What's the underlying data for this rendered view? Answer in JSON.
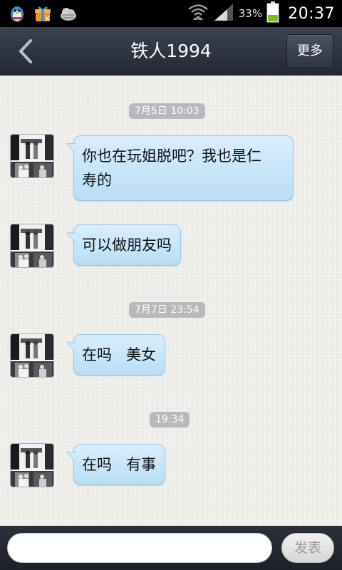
{
  "status_bar": {
    "battery_percent": "33%",
    "time": "20:37",
    "notification_icons": [
      "qq-penguin-icon",
      "gift-box-icon",
      "cloud-icon"
    ]
  },
  "title_bar": {
    "title": "铁人1994",
    "more_label": "更多"
  },
  "chat": {
    "timestamps": [
      "7月5日 10:03",
      "7月7日 23:54",
      "19:34"
    ],
    "messages": [
      {
        "line1": "你也在玩姐脱吧？我也是仁",
        "line2": "寿的"
      },
      {
        "line1": "可以做朋友吗",
        "line2": ""
      },
      {
        "line1": "在吗   美女",
        "line2": ""
      },
      {
        "line1": "在吗   有事",
        "line2": ""
      }
    ]
  },
  "input_bar": {
    "input_value": "",
    "send_label": "发表"
  },
  "colors": {
    "bubble": "#c8e6f9",
    "bar_dark": "#2b313c",
    "chat_bg": "#eeedea"
  }
}
